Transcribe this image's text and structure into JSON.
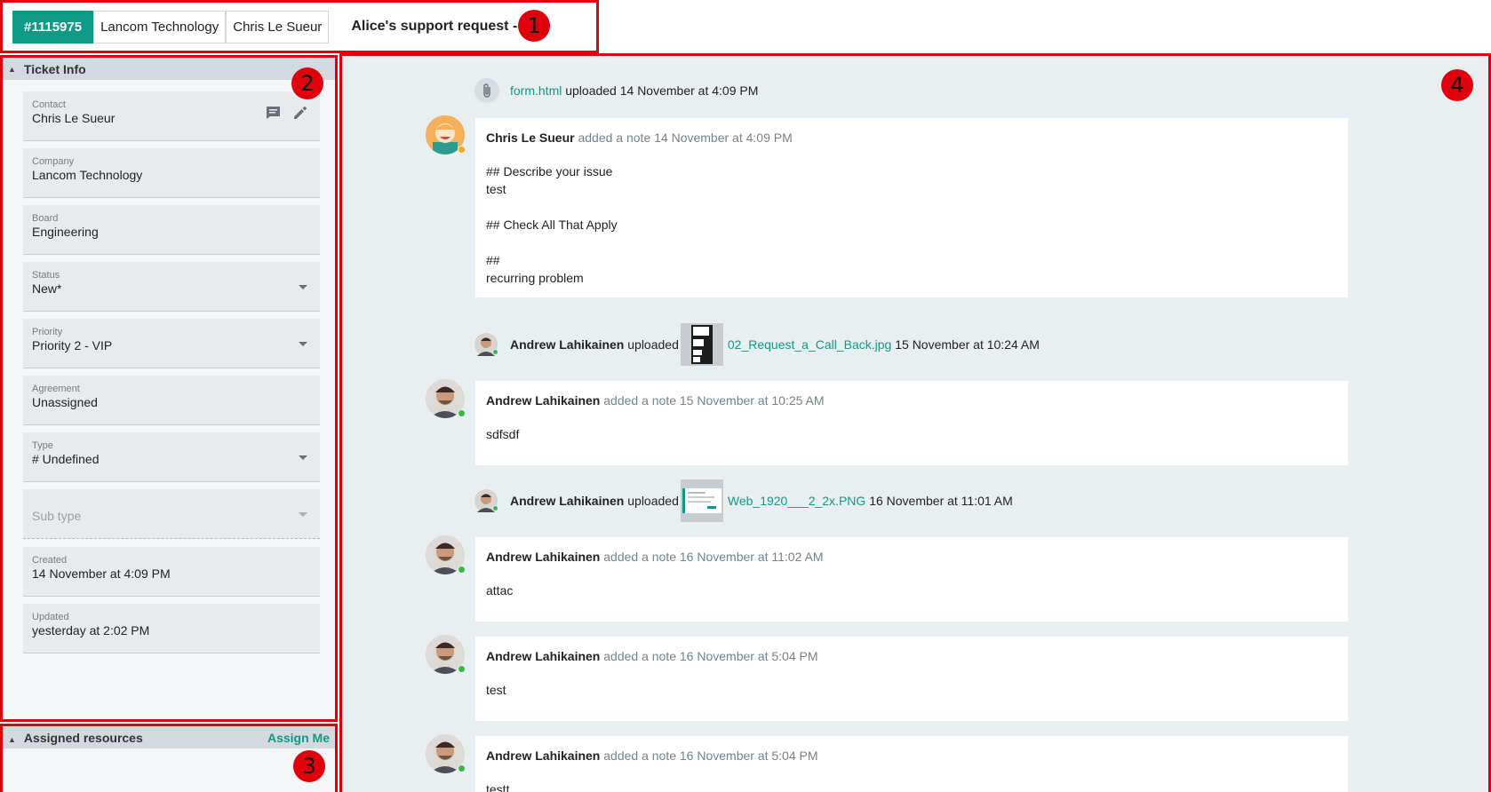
{
  "header": {
    "ticket_id": "#1115975",
    "company": "Lancom Technology",
    "contact": "Chris Le Sueur",
    "title": "Alice's support request - test",
    "marker": "1"
  },
  "ticket_info": {
    "section_title": "Ticket Info",
    "marker": "2",
    "fields": {
      "contact": {
        "label": "Contact",
        "value": "Chris Le Sueur"
      },
      "company": {
        "label": "Company",
        "value": "Lancom Technology"
      },
      "board": {
        "label": "Board",
        "value": "Engineering"
      },
      "status": {
        "label": "Status",
        "value": "New*"
      },
      "priority": {
        "label": "Priority",
        "value": "Priority 2 - VIP"
      },
      "agreement": {
        "label": "Agreement",
        "value": "Unassigned"
      },
      "type": {
        "label": "Type",
        "value": "# Undefined"
      },
      "subtype": {
        "placeholder": "Sub type"
      },
      "created": {
        "label": "Created",
        "value": "14 November at 4:09 PM"
      },
      "updated": {
        "label": "Updated",
        "value": "yesterday at 2:02 PM"
      }
    }
  },
  "assigned": {
    "section_title": "Assigned resources",
    "assign_me": "Assign Me",
    "marker": "3"
  },
  "activity": {
    "marker": "4",
    "events": [
      {
        "file": "form.html",
        "text": "uploaded 14 November at 4:09 PM"
      },
      {
        "author": "Chris Le Sueur",
        "meta": "added a note 14 November at 4:09 PM",
        "lines": [
          "## Describe your issue",
          "test",
          "",
          "## Check All That Apply",
          "",
          "##",
          "recurring problem"
        ]
      },
      {
        "author": "Andrew Lahikainen",
        "verb": "uploaded",
        "file": "02_Request_a_Call_Back.jpg",
        "time": "15 November at 10:24 AM"
      },
      {
        "author": "Andrew Lahikainen",
        "meta": "added a note 15 November at 10:25 AM",
        "lines": [
          "sdfsdf"
        ]
      },
      {
        "author": "Andrew Lahikainen",
        "verb": "uploaded",
        "file": "Web_1920___2_2x.PNG",
        "time": "16 November at 11:01 AM"
      },
      {
        "author": "Andrew Lahikainen",
        "meta": "added a note 16 November at 11:02 AM",
        "lines": [
          "attac"
        ]
      },
      {
        "author": "Andrew Lahikainen",
        "meta": "added a note 16 November at 5:04 PM",
        "lines": [
          "test"
        ]
      },
      {
        "author": "Andrew Lahikainen",
        "meta": "added a note 16 November at 5:04 PM",
        "lines": [
          "testt"
        ]
      }
    ]
  },
  "icons": [
    "collapse-triangle-icon",
    "message-icon",
    "edit-pencil-icon",
    "dropdown-caret-icon",
    "paperclip-icon",
    "avatar"
  ],
  "colors": {
    "accent": "#0e9a87",
    "annotation": "#e0000c",
    "online": "#3cb44b",
    "away": "#f5a623"
  }
}
